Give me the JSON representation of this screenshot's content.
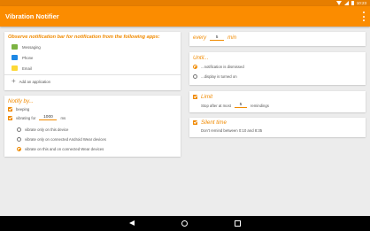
{
  "status_bar": {
    "time": "10:23"
  },
  "app_bar": {
    "title": "Vibration Notifier"
  },
  "apps_card": {
    "heading": "Observe notification bar for notification from the following apps:",
    "apps": [
      {
        "label": "Messaging",
        "icon": "messaging-icon",
        "color": "#7cb342"
      },
      {
        "label": "Phone",
        "icon": "phone-icon",
        "color": "#1e88e5"
      },
      {
        "label": "Email",
        "icon": "email-icon",
        "color": "#fdd835"
      }
    ],
    "add_label": "Add an application"
  },
  "notify_card": {
    "heading": "Notify by...",
    "beeping_label": "beeping",
    "vibrating_label": "vibrating for",
    "vibrating_value": "1000",
    "vibrating_unit": "ms",
    "radio_options": [
      "vibrate only on this device",
      "vibrate only on connected Android Wear devices",
      "vibrate on this and on connected Wear devices"
    ],
    "selected_option": 2
  },
  "every_card": {
    "every_label": "every",
    "value": "5",
    "unit": "min"
  },
  "until_card": {
    "heading": "Until...",
    "options": [
      "...notification is dismissed",
      "...display is turned on"
    ],
    "selected_option": 0
  },
  "limit_card": {
    "heading": "Limit",
    "stop_label": "Stop after at most",
    "value": "5",
    "unit": "remindings"
  },
  "silent_card": {
    "heading": "Silent time",
    "text": "Don't remind between 0:10 and 8:35"
  },
  "colors": {
    "accent": "#f08a00",
    "app_bar": "#fb8c00",
    "status_bar": "#e67e00"
  }
}
